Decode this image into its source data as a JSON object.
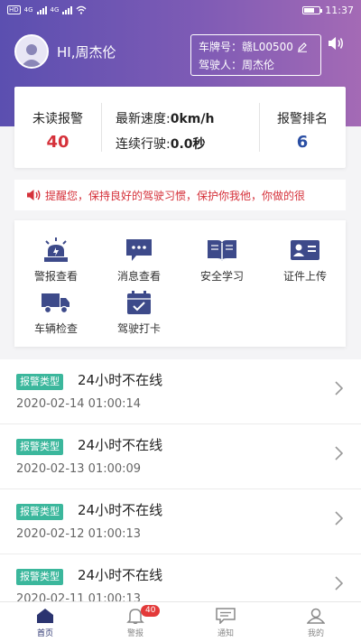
{
  "status_bar": {
    "left_icons": [
      "hd-icon",
      "signal-4g-icon",
      "signal-4g-icon",
      "wifi-icon"
    ],
    "network_labels": [
      "HD",
      "4G",
      "4G"
    ],
    "time": "11:37"
  },
  "user": {
    "greeting": "HI,周杰伦"
  },
  "vehicle": {
    "plate_label": "车牌号：",
    "plate_value": "赣L00500",
    "driver_label": "驾驶人：",
    "driver_value": "周杰伦"
  },
  "stats": {
    "unread_label": "未读报警",
    "unread_value": "40",
    "speed_label": "最新速度:",
    "speed_value": "0km/h",
    "driving_label": "连续行驶:",
    "driving_value": "0.0秒",
    "rank_label": "报警排名",
    "rank_value": "6"
  },
  "notice": {
    "text": "提醒您，保持良好的驾驶习惯，保护你我他，你做的很"
  },
  "menu": {
    "items": [
      {
        "label": "警报查看",
        "icon": "alarm-light-icon"
      },
      {
        "label": "消息查看",
        "icon": "message-icon"
      },
      {
        "label": "安全学习",
        "icon": "book-icon"
      },
      {
        "label": "证件上传",
        "icon": "id-card-icon"
      },
      {
        "label": "车辆检查",
        "icon": "truck-icon"
      },
      {
        "label": "驾驶打卡",
        "icon": "calendar-check-icon"
      }
    ]
  },
  "alerts": [
    {
      "tag": "报警类型",
      "title": "24小时不在线",
      "time": "2020-02-14 01:00:14"
    },
    {
      "tag": "报警类型",
      "title": "24小时不在线",
      "time": "2020-02-13 01:00:09"
    },
    {
      "tag": "报警类型",
      "title": "24小时不在线",
      "time": "2020-02-12 01:00:13"
    },
    {
      "tag": "报警类型",
      "title": "24小时不在线",
      "time": "2020-02-11 01:00:13"
    }
  ],
  "tabbar": {
    "items": [
      {
        "label": "首页",
        "icon": "home-icon"
      },
      {
        "label": "警报",
        "icon": "bell-icon"
      },
      {
        "label": "通知",
        "icon": "notice-icon"
      },
      {
        "label": "我的",
        "icon": "user-icon"
      }
    ],
    "alarm_badge": "40"
  },
  "colors": {
    "header_start": "#5b4fb0",
    "header_end": "#a46ab5",
    "alert_red": "#d5313a",
    "rank_blue": "#2a4ea3",
    "tag_green": "#3bb79c",
    "icon_navy": "#3d4a8a"
  }
}
